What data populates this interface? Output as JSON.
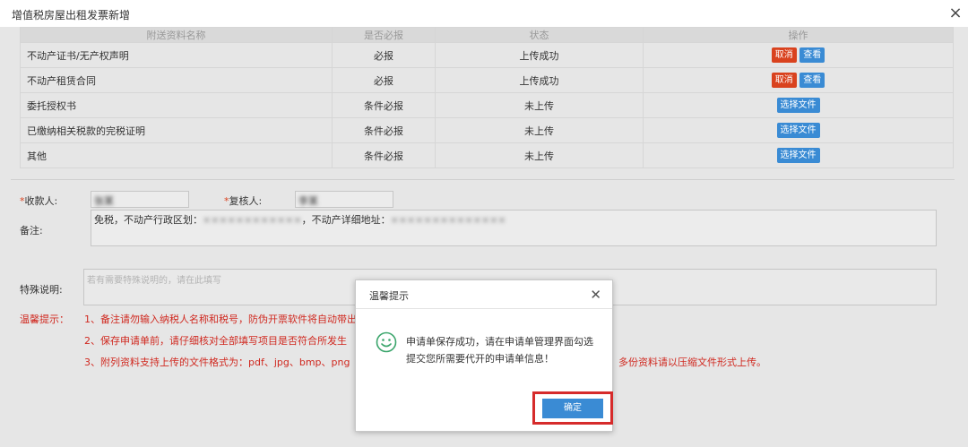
{
  "window": {
    "title": "增值税房屋出租发票新增"
  },
  "table": {
    "headers": [
      "附送资料名称",
      "是否必报",
      "状态",
      "操作"
    ],
    "rows": [
      {
        "name": "不动产证书/无产权声明",
        "required": "必报",
        "status": "上传成功",
        "actions": [
          "取消",
          "查看"
        ]
      },
      {
        "name": "不动产租赁合同",
        "required": "必报",
        "status": "上传成功",
        "actions": [
          "取消",
          "查看"
        ]
      },
      {
        "name": "委托授权书",
        "required": "条件必报",
        "status": "未上传",
        "actions": [
          "选择文件"
        ]
      },
      {
        "name": "已缴纳相关税款的完税证明",
        "required": "条件必报",
        "status": "未上传",
        "actions": [
          "选择文件"
        ]
      },
      {
        "name": "其他",
        "required": "条件必报",
        "status": "未上传",
        "actions": [
          "选择文件"
        ]
      }
    ]
  },
  "form": {
    "payee_label": "收款人:",
    "payee_value": "张某",
    "reviewer_label": "复核人:",
    "reviewer_value": "李某",
    "remark_label": "备注:",
    "remark_value_prefix": "免税，不动产行政区划：",
    "remark_value_masked_1": "××××××××××××",
    "remark_value_mid": "，不动产详细地址：",
    "remark_value_masked_2": "××××××××××××××",
    "special_label": "特殊说明:",
    "special_placeholder": "若有需要特殊说明的，请在此填写"
  },
  "tips": {
    "label": "温馨提示：",
    "line1": "1、备注请勿输入纳税人名称和税号，防伪开票软件将自动带出",
    "line2": "2、保存申请单前，请仔细核对全部填写项目是否符合所发生",
    "line3_start": "3、附列资料支持上传的文件格式为：pdf、jpg、bmp、png",
    "line3_end": "多份资料请以压缩文件形式上传。"
  },
  "dialog": {
    "title": "温馨提示",
    "message": "申请单保存成功，请在申请单管理界面勾选提交您所需要代开的申请单信息！",
    "ok_label": "确定"
  },
  "colors": {
    "accent": "#3a8bd4",
    "danger": "#d9421e",
    "tip_text": "#d0281f",
    "highlight": "#d62b2b",
    "smiley": "#3aa56b"
  },
  "icons": {
    "close": "close-icon",
    "smiley": "smiley-icon"
  }
}
